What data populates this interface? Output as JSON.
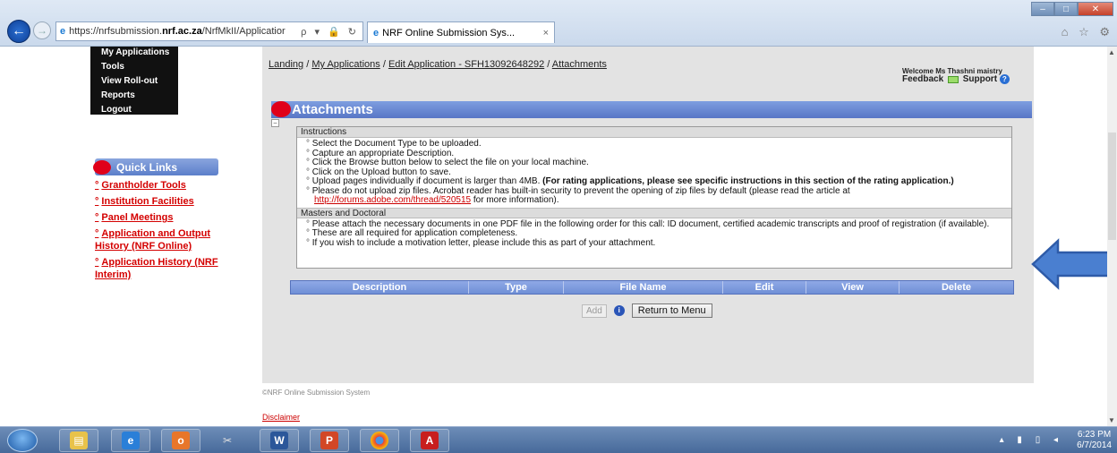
{
  "browser": {
    "url_part1": "https://nrfsubmission.",
    "url_part2": "nrf.ac.za",
    "url_part3": "/NrfMkII/Applicatior",
    "url_controls": "ρ ▾ 🔒 ↻",
    "tab_title": "NRF Online Submission Sys...",
    "tab_close": "×",
    "back_glyph": "←",
    "fwd_glyph": "→",
    "window_controls": [
      "–",
      "□",
      "✕"
    ],
    "right_icons": "⌂ ☆ ⚙"
  },
  "left_nav": [
    "My Applications",
    "Tools",
    "View Roll-out",
    "Reports",
    "Logout"
  ],
  "quick_links": {
    "title": "Quick Links",
    "items": [
      "Grantholder Tools",
      "Institution Facilities",
      "Panel Meetings",
      "Application and Output History (NRF Online)",
      "Application History (NRF Interim)"
    ]
  },
  "breadcrumb": {
    "items": [
      "Landing",
      "My Applications",
      "Edit Application - SFH13092648292",
      "Attachments"
    ],
    "sep": " / "
  },
  "welcome": "Welcome Ms Thashni maistry",
  "feedback": "Feedback",
  "support": "Support",
  "section_title": "Attachments",
  "collapse_glyph": "−",
  "instructions": {
    "header": "Instructions",
    "items": [
      "Select the Document Type to be uploaded.",
      "Capture an appropriate Description.",
      "Click the Browse button below to select the file on your local machine.",
      "Click on the Upload button to save."
    ],
    "upload_text": "Upload pages individually if document is larger than 4MB. ",
    "upload_bold": "(For rating applications, please see specific instructions in this section of the rating application.)",
    "zip_text": "Please do not upload zip files. Acrobat reader has built-in security to prevent the opening of zip files by default (please read the article at ",
    "zip_link": "http://forums.adobe.com/thread/520515",
    "zip_tail": " for more information)."
  },
  "masters": {
    "header": "Masters and Doctoral",
    "items": [
      "Please attach the necessary documents in one PDF file in the following order for this call: ID document, certified academic transcripts and proof of registration (if available).",
      "These are all required for application completeness.",
      "If you wish to include a motivation letter, please include this as part of your attachment."
    ]
  },
  "table_headers": [
    "Description",
    "Type",
    "File Name",
    "Edit",
    "View",
    "Delete"
  ],
  "buttons": {
    "add": "Add",
    "return": "Return to Menu",
    "info": "i"
  },
  "footer": {
    "copyright": "©NRF Online Submission System",
    "disclaimer": "Disclaimer"
  },
  "taskbar": {
    "time": "6:23 PM",
    "date": "6/7/2014",
    "tray": "▴ ▮ ▯ ◂"
  },
  "colors": {
    "accent": "#6a88d6",
    "link_red": "#d40000",
    "arrow": "#2e5ba8"
  }
}
